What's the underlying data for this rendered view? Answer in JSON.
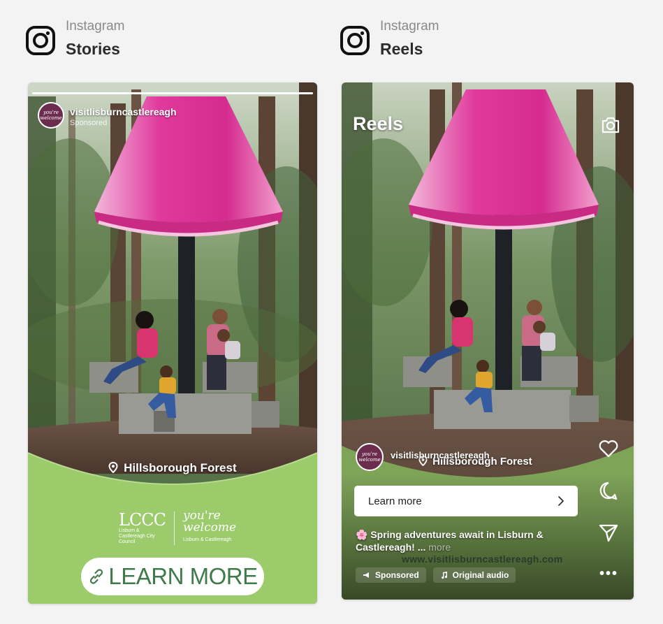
{
  "stories_panel": {
    "platform": "Instagram",
    "placement": "Stories",
    "account_handle": "visitlisburncastlereagh",
    "account_sponsored": "Sponsored",
    "progress": 1.0,
    "location": "Hillsborough Forest",
    "logo_mark": "LCCC",
    "logo_subtext": "Lisburn & Castlereagh City Council",
    "welcome_text": "you're welcome",
    "welcome_subtext": "Lisburn & Castlereagh",
    "cta_label": "LEARN MORE",
    "avatar_text": "you're welcome"
  },
  "reels_panel": {
    "platform": "Instagram",
    "placement": "Reels",
    "title": "Reels",
    "account_handle": "visitlisburncastlereagh",
    "location": "Hillsborough Forest",
    "cta_label": "Learn more",
    "caption": "🌸 Spring adventures await in Lisburn & Castlereagh! ...",
    "caption_more": "more",
    "url": "www.visitlisburncastlereagh.com",
    "sponsored_label": "Sponsored",
    "audio_label": "Original audio",
    "avatar_text": "you're welcome"
  },
  "colors": {
    "brand_green": "#9ccb6c",
    "cta_text_green": "#3f7a4a",
    "canopy_pink": "#e0389c",
    "avatar_plum": "#6b2c4e"
  },
  "icons": [
    "instagram-icon",
    "link-icon",
    "map-pin-icon",
    "camera-icon",
    "heart-icon",
    "comment-icon",
    "send-icon",
    "chevron-right-icon",
    "more-icon"
  ]
}
